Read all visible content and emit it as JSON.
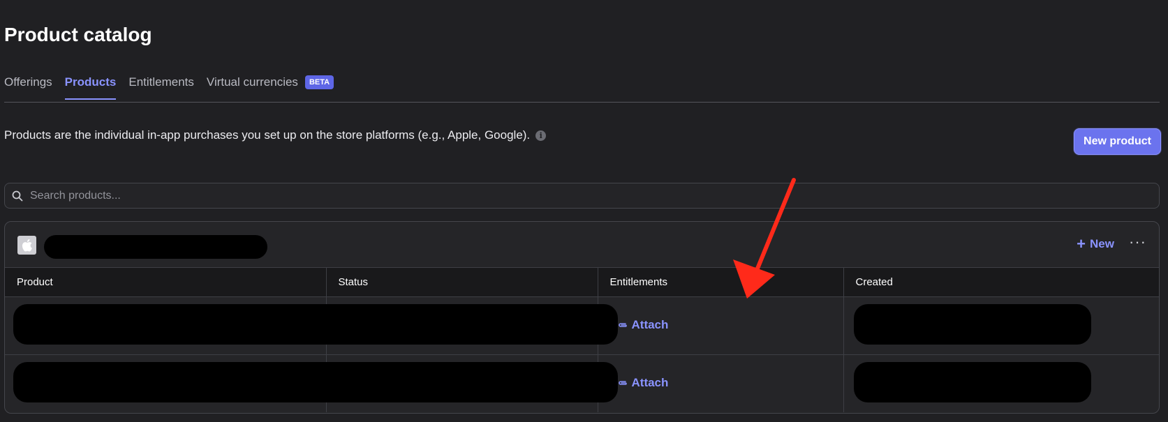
{
  "page": {
    "title": "Product catalog"
  },
  "tabs": [
    {
      "label": "Offerings",
      "active": false
    },
    {
      "label": "Products",
      "active": true
    },
    {
      "label": "Entitlements",
      "active": false
    },
    {
      "label": "Virtual currencies",
      "active": false,
      "badge": "BETA"
    }
  ],
  "description": "Products are the individual in-app purchases you set up on the store platforms (e.g., Apple, Google).",
  "actions": {
    "new_product_label": "New product"
  },
  "search": {
    "placeholder": "Search products..."
  },
  "app_panel": {
    "platform_icon": "apple-icon",
    "new_label": "New",
    "more_label": "···",
    "columns": [
      "Product",
      "Status",
      "Entitlements",
      "Created"
    ],
    "rows": [
      {
        "entitlements_action": "Attach"
      },
      {
        "entitlements_action": "Attach"
      }
    ]
  },
  "colors": {
    "accent": "#8a93ff",
    "primary_button": "#6b73ee",
    "background": "#202023",
    "annotation_arrow": "#ff2a1a"
  }
}
